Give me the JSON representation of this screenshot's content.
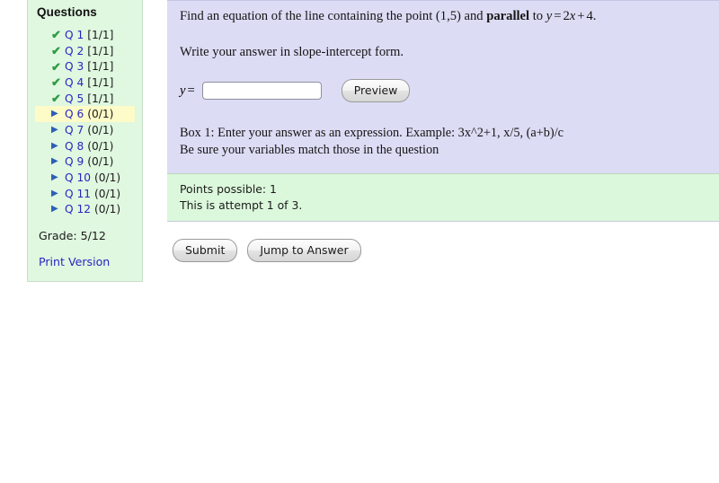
{
  "sidebar": {
    "title": "Questions",
    "questions": [
      {
        "marker": "check-icon",
        "label": "Q 1",
        "score": "[1/1]",
        "status": "done",
        "current": false
      },
      {
        "marker": "check-icon",
        "label": "Q 2",
        "score": "[1/1]",
        "status": "done",
        "current": false
      },
      {
        "marker": "check-icon",
        "label": "Q 3",
        "score": "[1/1]",
        "status": "done",
        "current": false
      },
      {
        "marker": "check-icon",
        "label": "Q 4",
        "score": "[1/1]",
        "status": "done",
        "current": false
      },
      {
        "marker": "check-icon",
        "label": "Q 5",
        "score": "[1/1]",
        "status": "done",
        "current": false
      },
      {
        "marker": "triangle-right-icon",
        "label": "Q 6",
        "score": "(0/1)",
        "status": "todo",
        "current": true
      },
      {
        "marker": "triangle-right-icon",
        "label": "Q 7",
        "score": "(0/1)",
        "status": "todo",
        "current": false
      },
      {
        "marker": "triangle-right-icon",
        "label": "Q 8",
        "score": "(0/1)",
        "status": "todo",
        "current": false
      },
      {
        "marker": "triangle-right-icon",
        "label": "Q 9",
        "score": "(0/1)",
        "status": "todo",
        "current": false
      },
      {
        "marker": "triangle-right-icon",
        "label": "Q 10",
        "score": "(0/1)",
        "status": "todo",
        "current": false
      },
      {
        "marker": "triangle-right-icon",
        "label": "Q 11",
        "score": "(0/1)",
        "status": "todo",
        "current": false
      },
      {
        "marker": "triangle-right-icon",
        "label": "Q 12",
        "score": "(0/1)",
        "status": "todo",
        "current": false
      }
    ],
    "grade": "Grade: 5/12",
    "print_version": "Print Version",
    "colors": {
      "background": "#e0f7e0",
      "border": "#c8dcc8",
      "current_highlight": "#fdfbc8",
      "link": "#2727c0",
      "check": "#2e9c43",
      "triangle": "#2b5fb8"
    }
  },
  "problem": {
    "statement_part1": "Find an equation of the line containing the point (1,5) and ",
    "statement_emphasis": "parallel",
    "statement_part2": " to ",
    "math_y": "y",
    "math_equals": "=",
    "math_coefficient": "2",
    "math_x": "x",
    "math_plus": "+",
    "math_constant": "4",
    "statement_end": ".",
    "instruction": "Write your answer in slope-intercept form.",
    "answer_label_var": "y",
    "answer_label_eq": "=",
    "answer_value": "",
    "answer_placeholder": "",
    "preview_button": "Preview",
    "hint_line1": "Box 1: Enter your answer as an expression. Example: 3x^2+1, x/5, (a+b)/c",
    "hint_line2": "Be sure your variables match those in the question",
    "panel_color": "#dcdcf5"
  },
  "points": {
    "possible": "Points possible: 1",
    "attempt": "This is attempt 1 of 3.",
    "panel_color": "#dcf8dc"
  },
  "actions": {
    "submit": "Submit",
    "jump_to_answer": "Jump to Answer"
  }
}
